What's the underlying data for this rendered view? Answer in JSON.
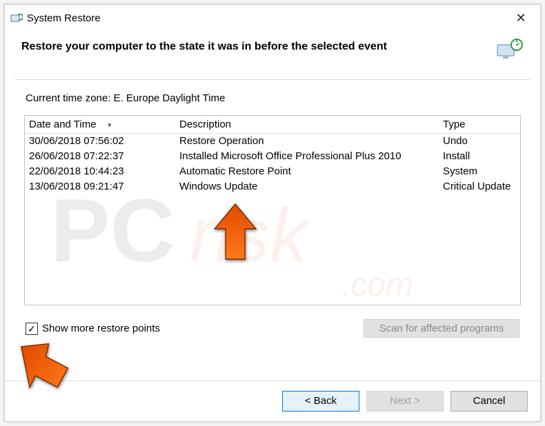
{
  "window": {
    "title": "System Restore",
    "heading": "Restore your computer to the state it was in before the selected event",
    "timezone": "Current time zone: E. Europe Daylight Time"
  },
  "columns": {
    "date": "Date and Time",
    "description": "Description",
    "type": "Type"
  },
  "rows": [
    {
      "dt": "30/06/2018 07:56:02",
      "desc": "Restore Operation",
      "type": "Undo"
    },
    {
      "dt": "26/06/2018 07:22:37",
      "desc": "Installed Microsoft Office Professional Plus 2010",
      "type": "Install"
    },
    {
      "dt": "22/06/2018 10:44:23",
      "desc": "Automatic Restore Point",
      "type": "System"
    },
    {
      "dt": "13/06/2018 09:21:47",
      "desc": "Windows Update",
      "type": "Critical Update"
    }
  ],
  "controls": {
    "show_more": "Show more restore points",
    "scan": "Scan for affected programs",
    "back": "<  Back",
    "next": "Next  >",
    "cancel": "Cancel"
  },
  "watermark": "PCrisk.com"
}
